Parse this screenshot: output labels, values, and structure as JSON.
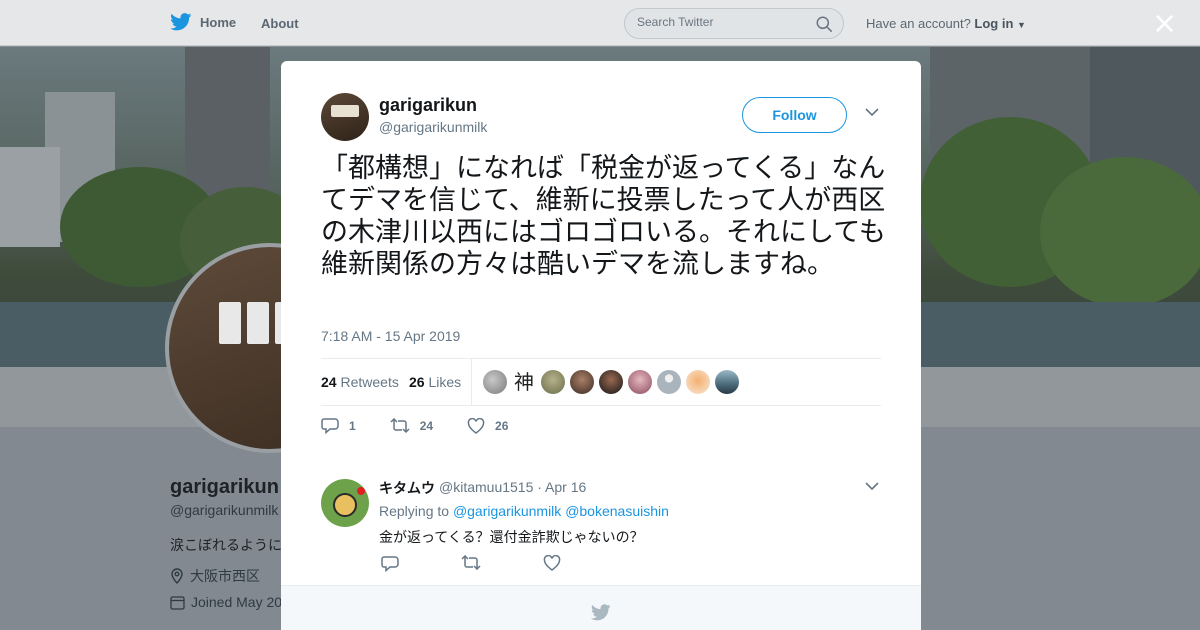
{
  "topbar": {
    "home_label": "Home",
    "about_label": "About",
    "search_placeholder": "Search Twitter",
    "have_account": "Have an account?",
    "login_label": "Log in"
  },
  "close_glyph": "×",
  "profile": {
    "name": "garigarikun",
    "handle": "@garigarikunmilk",
    "bio": "涙こぼれるように",
    "location": "大阪市西区",
    "joined": "Joined May 20"
  },
  "tweet": {
    "name": "garigarikun",
    "handle": "@garigarikunmilk",
    "follow_label": "Follow",
    "text": "「都構想」になれば「税金が返ってくる」なんてデマを信じて、維新に投票したって人が西区の木津川以西にはゴロゴロいる。それにしても維新関係の方々は酷いデマを流しますね。",
    "timestamp": "7:18 AM - 15 Apr 2019",
    "retweets_count": "24",
    "retweets_label": "Retweets",
    "likes_count": "26",
    "likes_label": "Likes",
    "liker_kanji": "神",
    "reply_count": "1",
    "retweet_action_count": "24",
    "like_action_count": "26"
  },
  "reply": {
    "name": "キタムウ",
    "handle": "@kitamuu1515 · Apr 16",
    "replying_prefix": "Replying to",
    "replying_to_1": "@garigarikunmilk",
    "replying_to_2": "@bokenasuishin",
    "text": "金が返ってくる？還付金詐欺じゃないの？"
  },
  "colors": {
    "twitter_blue": "#1b95e0",
    "secondary_text": "#657786",
    "primary_text": "#14171a"
  },
  "icons": [
    "twitter-bird-icon",
    "search-icon",
    "close-icon",
    "chevron-down-icon",
    "reply-icon",
    "retweet-icon",
    "heart-icon",
    "location-icon",
    "calendar-icon"
  ]
}
